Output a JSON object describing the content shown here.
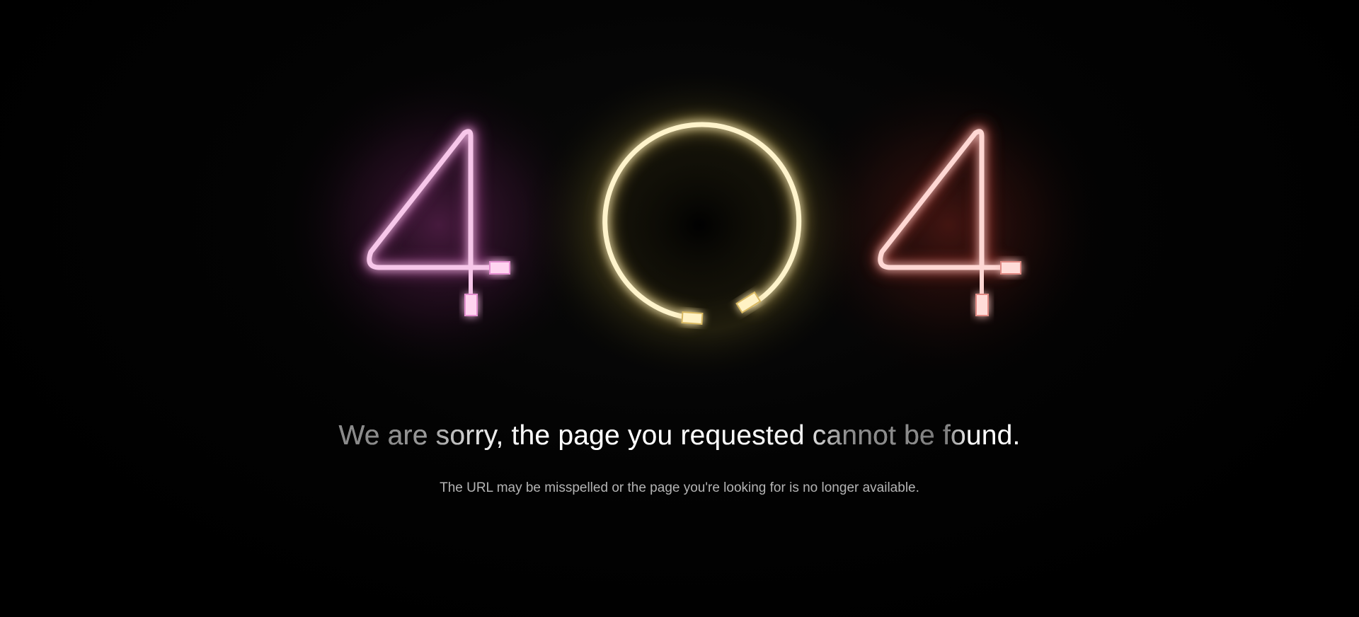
{
  "error": {
    "digits": [
      "4",
      "0",
      "4"
    ],
    "headline": "We are sorry, the page you requested cannot be found.",
    "message": "The URL may be misspelled or the page you're looking for is no longer available."
  },
  "colors": {
    "background": "#000000",
    "digit_left_glow": "#c04fa8",
    "digit_middle_glow": "#e8c860",
    "digit_right_glow": "#d0443a",
    "tube_core": "#fff6fb",
    "message_text": "#b4b4b4"
  },
  "icons": {
    "digit_left": "neon-four-icon",
    "digit_middle": "neon-zero-icon",
    "digit_right": "neon-four-icon"
  }
}
